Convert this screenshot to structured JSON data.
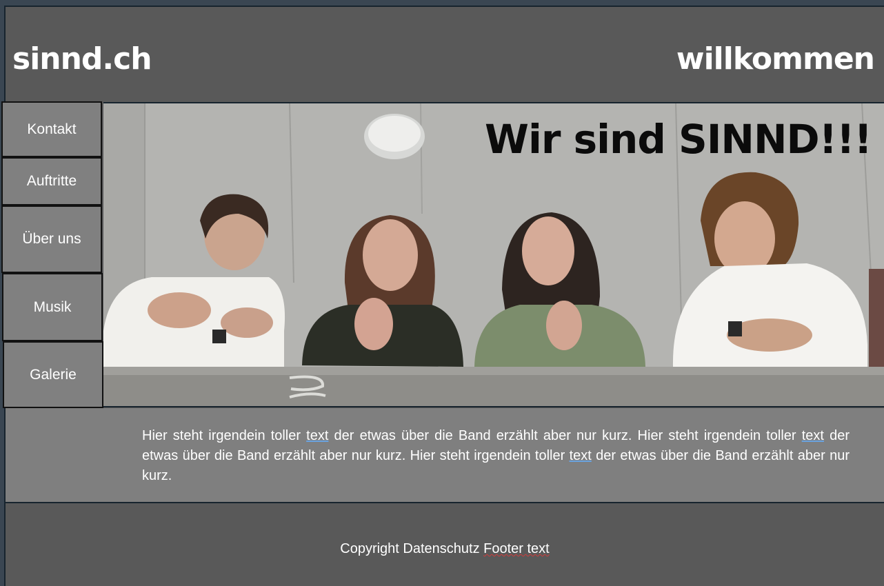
{
  "header": {
    "logo": "sinnd.ch",
    "welcome": "willkommen"
  },
  "sidebar": {
    "items": [
      {
        "label": "Kontakt"
      },
      {
        "label": "Auftritte"
      },
      {
        "label": "Über uns"
      },
      {
        "label": "Musik"
      },
      {
        "label": "Galerie"
      }
    ]
  },
  "hero": {
    "title": "Wir sind SINND!!!"
  },
  "intro": {
    "part1": "Hier steht irgendein toller ",
    "link": "text",
    "part2": " der etwas über die Band erzählt aber nur kurz. Hier steht irgendein toller ",
    "part3": " der etwas über die Band erzählt aber nur kurz. Hier steht irgendein toller ",
    "part4": " der etwas über die Band erzählt aber nur kurz."
  },
  "footer": {
    "copyright": "Copyright Datenschutz ",
    "footer_text": "Footer text"
  },
  "colors": {
    "header_bg": "#595959",
    "nav_bg": "#808080",
    "content_bg": "#7f7f7f",
    "border": "#17242e"
  }
}
